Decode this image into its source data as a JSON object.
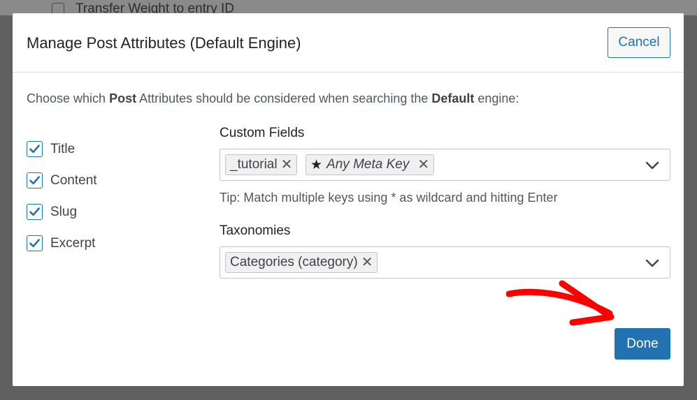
{
  "background": {
    "partial_text": "Transfer Weight to entry ID"
  },
  "modal": {
    "title": "Manage Post Attributes (Default Engine)",
    "cancel_label": "Cancel",
    "intro": {
      "part1": "Choose which ",
      "bold1": "Post",
      "part2": " Attributes should be considered when searching the ",
      "bold2": "Default",
      "part3": " engine:"
    },
    "attributes": [
      {
        "label": "Title",
        "checked": true
      },
      {
        "label": "Content",
        "checked": true
      },
      {
        "label": "Slug",
        "checked": true
      },
      {
        "label": "Excerpt",
        "checked": true
      }
    ],
    "custom_fields": {
      "label": "Custom Fields",
      "chips": [
        "_tutorial",
        "Any Meta Key"
      ],
      "tip": "Tip: Match multiple keys using * as wildcard and hitting Enter"
    },
    "taxonomies": {
      "label": "Taxonomies",
      "chips": [
        "Categories (category)"
      ]
    },
    "done_label": "Done"
  },
  "colors": {
    "accent": "#2271b1",
    "annotation_arrow": "#ff0000"
  },
  "icons": [
    "checkbox-check-icon",
    "chip-remove-icon",
    "star-icon",
    "chevron-down-icon",
    "red-arrow-annotation"
  ]
}
